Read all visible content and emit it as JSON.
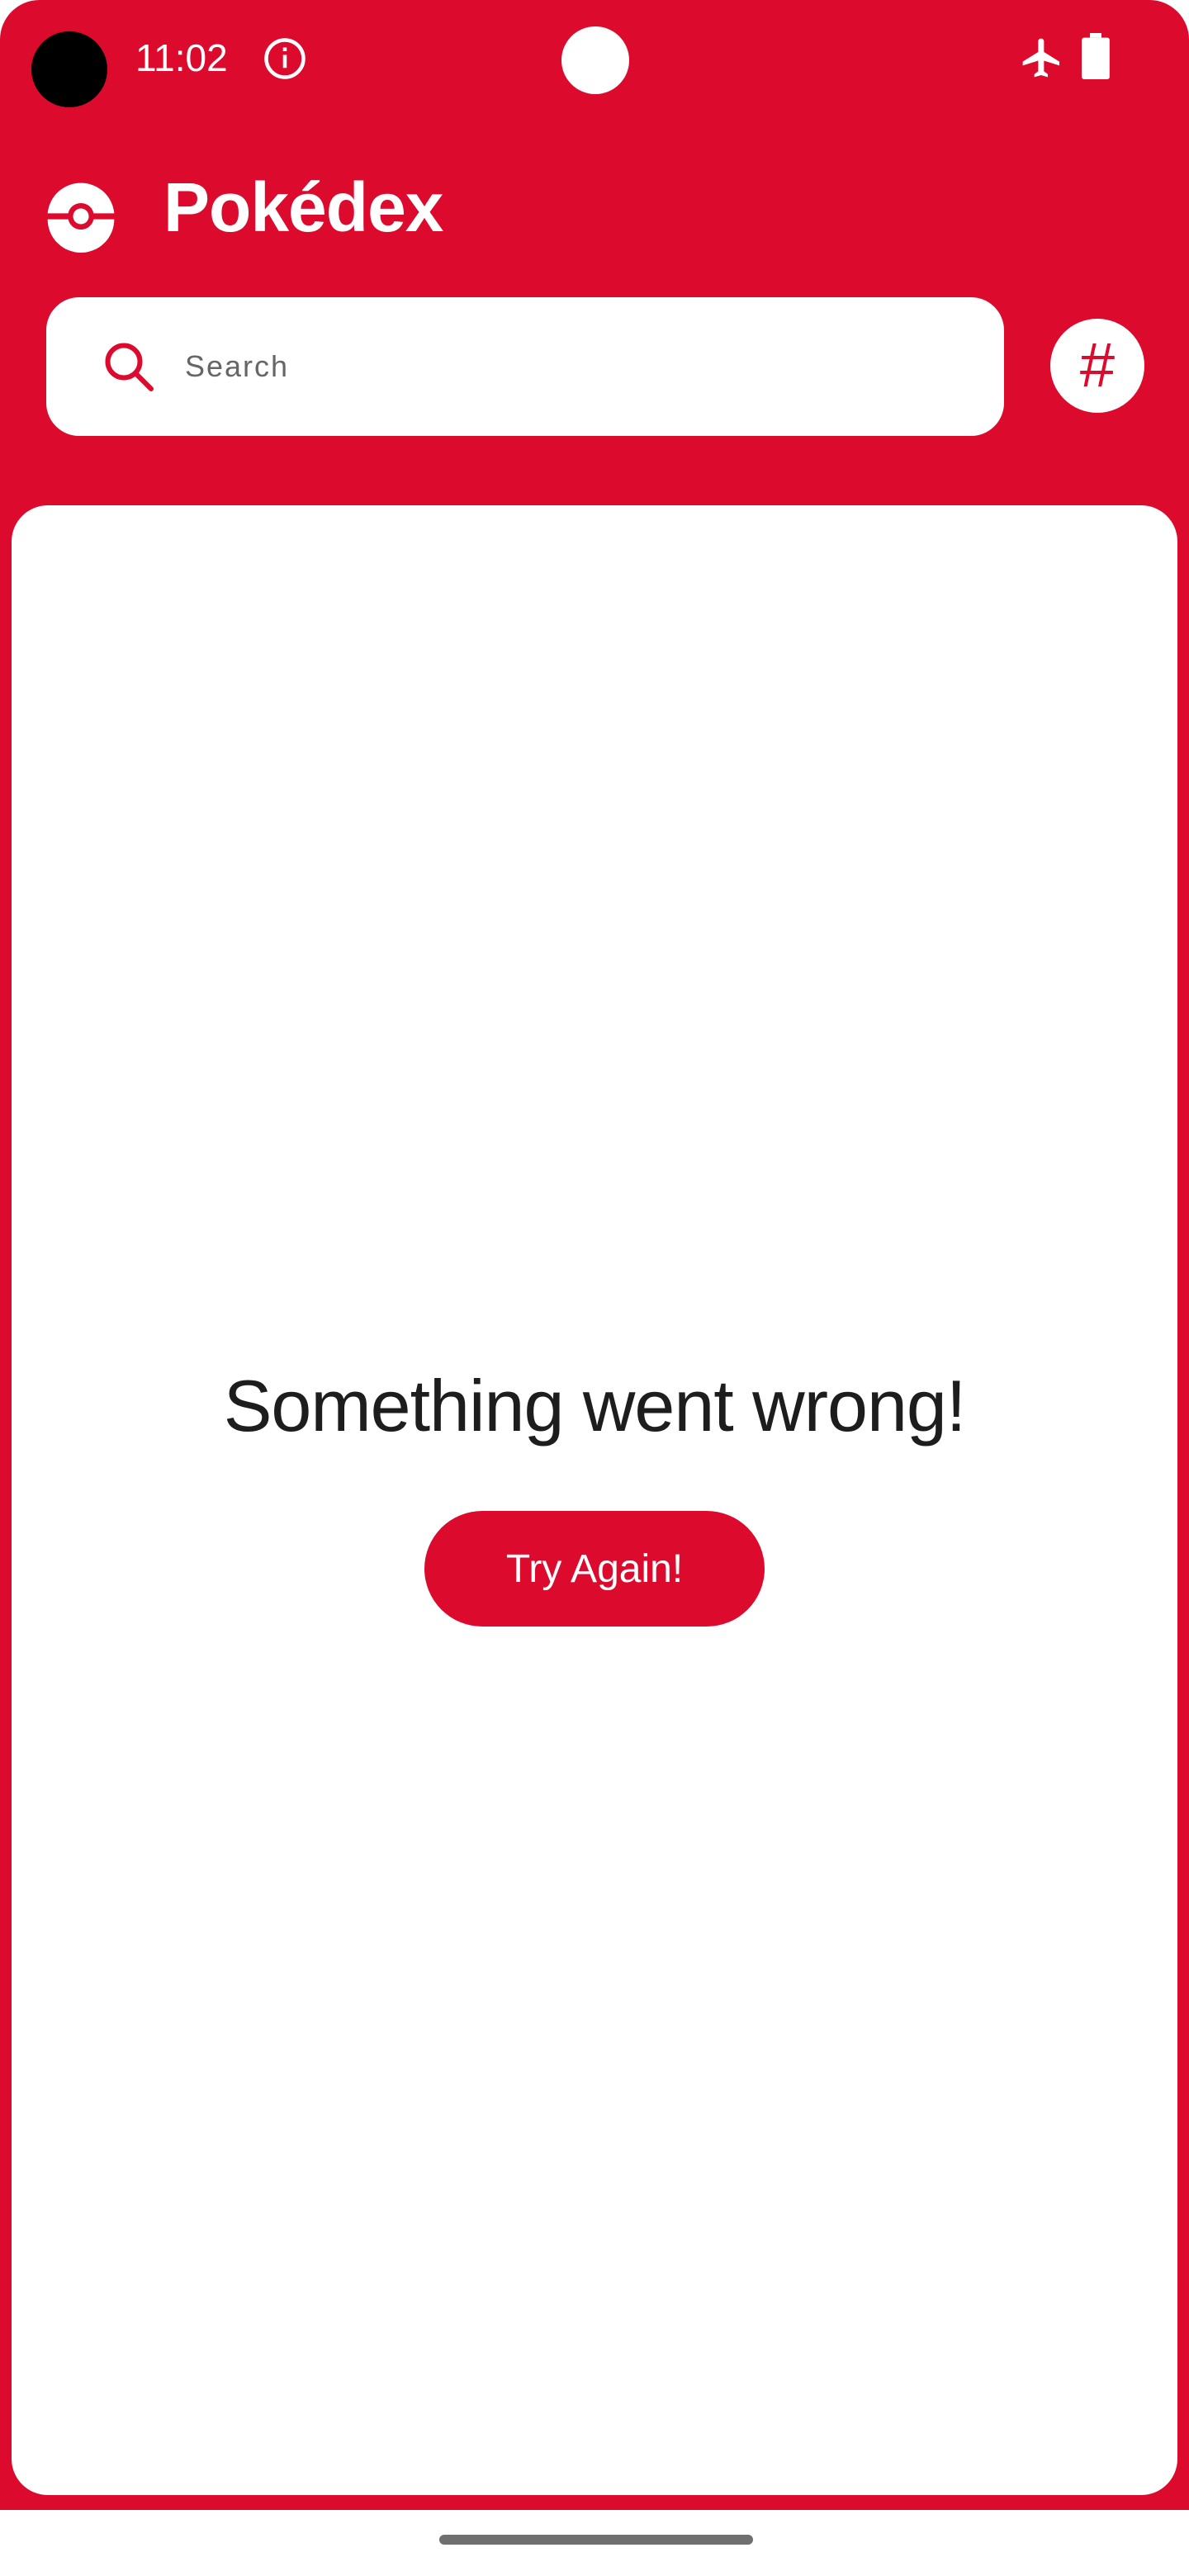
{
  "status_bar": {
    "time": "11:02",
    "icons": [
      "info-icon",
      "airplane-icon",
      "battery-icon"
    ]
  },
  "header": {
    "title": "Pokédex",
    "logo_icon": "pokeball-icon"
  },
  "search": {
    "placeholder": "Search",
    "value": "",
    "icon": "search-icon"
  },
  "sort_button": {
    "label": "#"
  },
  "content": {
    "error_message": "Something went wrong!",
    "retry_label": "Try Again!"
  },
  "colors": {
    "primary": "#DC0A2D",
    "background": "#FFFFFF",
    "text_dark": "#1D1D1D",
    "placeholder": "#666666"
  }
}
